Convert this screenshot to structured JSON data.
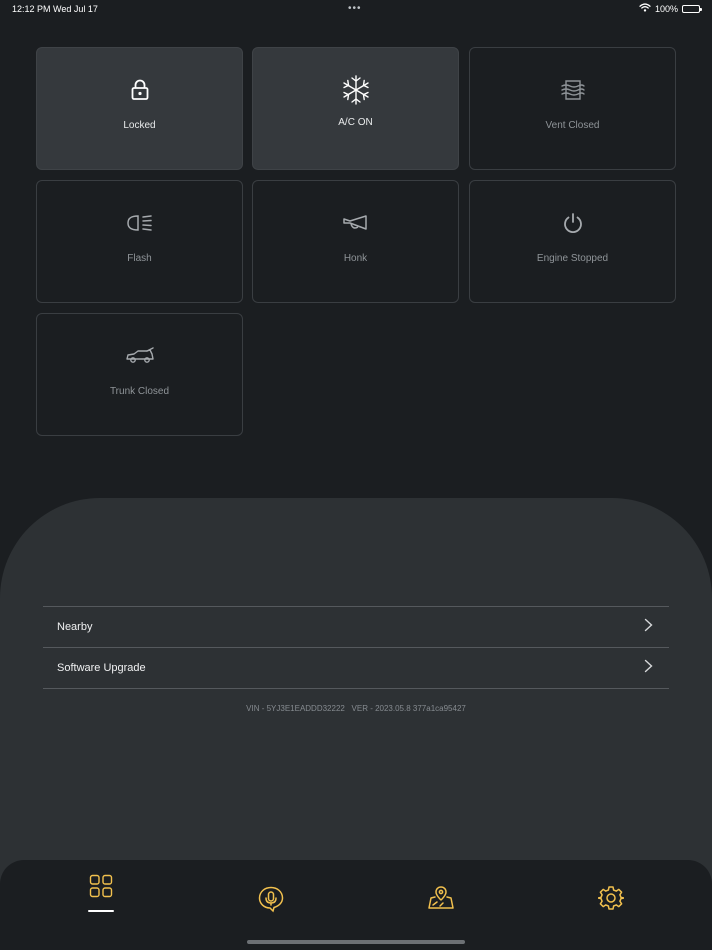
{
  "status_bar": {
    "time": "12:12 PM",
    "date": "Wed Jul 17",
    "multitask_dots": "•••",
    "battery": "100%",
    "wifi_icon": "wifi-icon",
    "battery_icon": "battery-icon"
  },
  "controls": [
    {
      "label": "Locked",
      "icon": "lock-icon",
      "active": true
    },
    {
      "label": "A/C ON",
      "icon": "snowflake-icon",
      "active": true
    },
    {
      "label": "Vent Closed",
      "icon": "vent-icon",
      "active": false
    },
    {
      "label": "Flash",
      "icon": "headlight-icon",
      "active": false
    },
    {
      "label": "Honk",
      "icon": "horn-icon",
      "active": false
    },
    {
      "label": "Engine Stopped",
      "icon": "power-icon",
      "active": false
    },
    {
      "label": "Trunk Closed",
      "icon": "trunk-icon",
      "active": false
    }
  ],
  "menu": [
    {
      "label": "Nearby"
    },
    {
      "label": "Software Upgrade"
    }
  ],
  "version_info": "VIN - 5YJ3E1EADDD32222   VER - 2023.05.8 377a1ca95427",
  "tabs": [
    {
      "icon": "grid-icon",
      "selected": true
    },
    {
      "icon": "voice-assistant-icon",
      "selected": false
    },
    {
      "icon": "map-icon",
      "selected": false
    },
    {
      "icon": "settings-gear-icon",
      "selected": false
    }
  ],
  "colors": {
    "background": "#1b1e21",
    "tile_active": "#35393d",
    "panel": "#2d3134",
    "accent": "#f2c14e"
  }
}
